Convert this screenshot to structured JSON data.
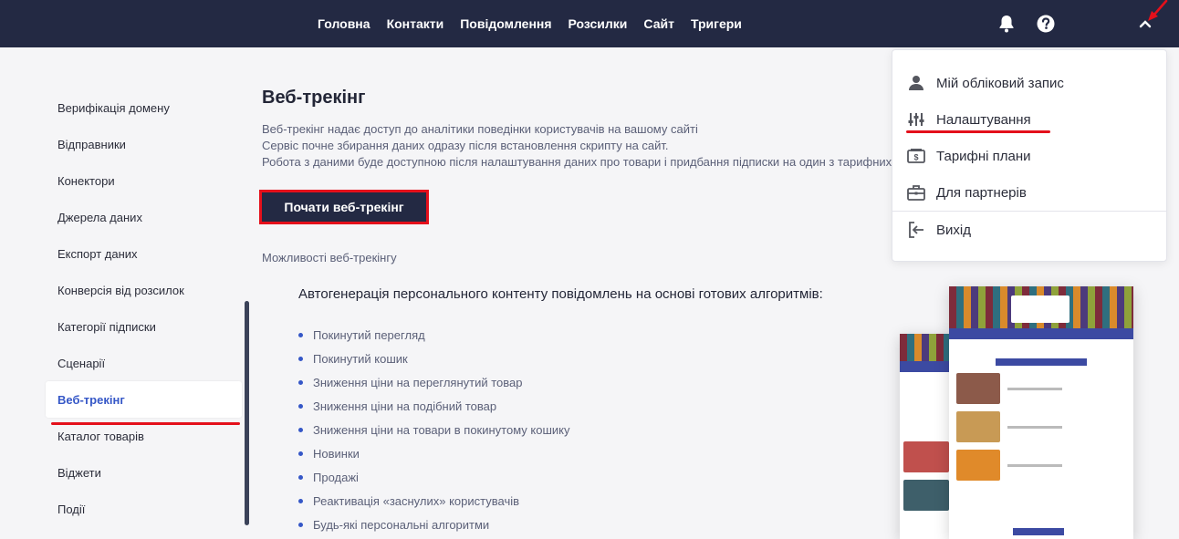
{
  "nav": {
    "items": [
      "Головна",
      "Контакти",
      "Повідомлення",
      "Розсилки",
      "Сайт",
      "Тригери"
    ]
  },
  "header_icons": [
    "bell-icon",
    "help-icon",
    "chevron-up-icon"
  ],
  "sidebar": {
    "items": [
      {
        "label": "Верифікація домену"
      },
      {
        "label": "Відправники"
      },
      {
        "label": "Конектори"
      },
      {
        "label": "Джерела даних"
      },
      {
        "label": "Експорт даних"
      },
      {
        "label": "Конверсія від розсилок"
      },
      {
        "label": "Категорії підписки"
      },
      {
        "label": "Сценарії"
      },
      {
        "label": "Веб-трекінг",
        "active": true
      },
      {
        "label": "Каталог товарів"
      },
      {
        "label": "Віджети"
      },
      {
        "label": "Події"
      }
    ]
  },
  "main": {
    "title": "Веб-трекінг",
    "description": [
      "Веб-трекінг надає доступ до аналітики поведінки користувачів на вашому сайті",
      "Сервіс почне збирання даних одразу після встановлення скрипту на сайт.",
      "Робота з даними буде доступною після налаштування даних про товари і придбання підписки на один з тарифних"
    ],
    "start_button": "Почати веб-трекінг",
    "capabilities_link": "Можливості веб-трекінгу",
    "capabilities_heading": "Автогенерація персонального контенту повідомлень на основі готових алгоритмів:",
    "features": [
      "Покинутий перегляд",
      "Покинутий кошик",
      "Зниження ціни на переглянутий товар",
      "Зниження ціни на подібний товар",
      "Зниження ціни на товари в покинутому кошику",
      "Новинки",
      "Продажі",
      "Реактивація «заснулих» користувачів",
      "Будь-які персональні алгоритми"
    ]
  },
  "dropdown": {
    "items": [
      {
        "label": "Мій обліковий запис",
        "icon": "user-icon"
      },
      {
        "label": "Налаштування",
        "icon": "sliders-icon"
      },
      {
        "label": "Тарифні плани",
        "icon": "tariff-icon"
      },
      {
        "label": "Для партнерів",
        "icon": "briefcase-icon"
      },
      {
        "label": "Вихід",
        "icon": "logout-icon"
      }
    ]
  },
  "colors": {
    "topbar": "#232943",
    "accent": "#3557c7",
    "highlight": "#e4101b"
  }
}
